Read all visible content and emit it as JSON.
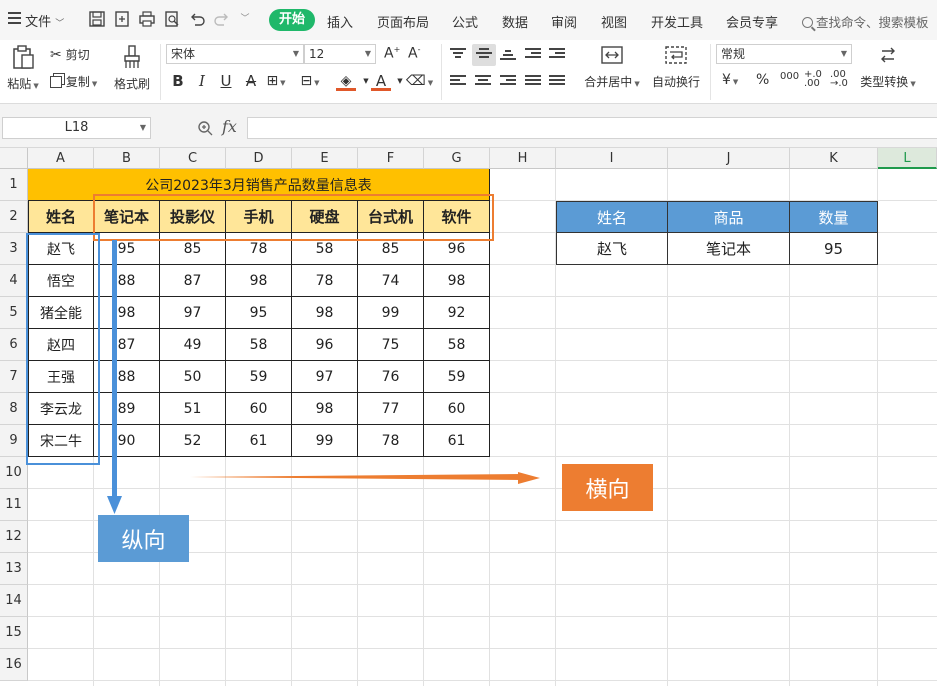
{
  "menubar": {
    "file_label": "文件",
    "tabs": [
      {
        "label": "开始",
        "active": true
      },
      {
        "label": "插入"
      },
      {
        "label": "页面布局"
      },
      {
        "label": "公式"
      },
      {
        "label": "数据"
      },
      {
        "label": "审阅"
      },
      {
        "label": "视图"
      },
      {
        "label": "开发工具"
      },
      {
        "label": "会员专享"
      }
    ],
    "search_placeholder": "查找命令、搜索模板"
  },
  "ribbon": {
    "paste": "粘贴",
    "cut": "剪切",
    "copy": "复制",
    "format_painter": "格式刷",
    "font_name": "宋体",
    "font_size": "12",
    "merge_center": "合并居中",
    "wrap_text": "自动换行",
    "number_format": "常规",
    "type_convert": "类型转换",
    "currency_symbol": "¥",
    "percent_symbol": "%",
    "thousands_symbol": "000"
  },
  "formula_bar": {
    "cell_ref": "L18",
    "fx": "fx",
    "value": ""
  },
  "grid": {
    "columns": [
      "A",
      "B",
      "C",
      "D",
      "E",
      "F",
      "G",
      "H",
      "I",
      "J",
      "K",
      "L"
    ],
    "selected_column": "L",
    "rows": [
      "1",
      "2",
      "3",
      "4",
      "5",
      "6",
      "7",
      "8",
      "9",
      "10",
      "11",
      "12",
      "13",
      "14",
      "15",
      "16"
    ]
  },
  "sheet": {
    "title": "公司2023年3月销售产品数量信息表",
    "headers": [
      "姓名",
      "笔记本",
      "投影仪",
      "手机",
      "硬盘",
      "台式机",
      "软件"
    ],
    "rows": [
      [
        "赵飞",
        "95",
        "85",
        "78",
        "58",
        "85",
        "96"
      ],
      [
        "悟空",
        "88",
        "87",
        "98",
        "78",
        "74",
        "98"
      ],
      [
        "猪全能",
        "98",
        "97",
        "95",
        "98",
        "99",
        "92"
      ],
      [
        "赵四",
        "87",
        "49",
        "58",
        "96",
        "75",
        "58"
      ],
      [
        "王强",
        "88",
        "50",
        "59",
        "97",
        "76",
        "59"
      ],
      [
        "李云龙",
        "89",
        "51",
        "60",
        "98",
        "77",
        "60"
      ],
      [
        "宋二牛",
        "90",
        "52",
        "61",
        "99",
        "78",
        "61"
      ]
    ]
  },
  "lookup": {
    "headers": [
      "姓名",
      "商品",
      "数量"
    ],
    "values": [
      "赵飞",
      "笔记本",
      "95"
    ]
  },
  "annotations": {
    "vertical_label": "纵向",
    "horizontal_label": "横向",
    "orange": "#ed7d31",
    "blue": "#5b9bd5"
  }
}
